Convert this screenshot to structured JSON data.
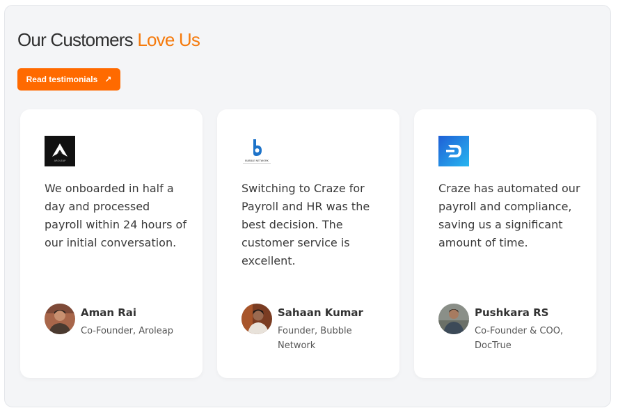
{
  "section": {
    "title_main": "Our Customers",
    "title_accent": "Love Us",
    "cta_label": "Read testimonials",
    "cta_icon": "arrow-up-right-icon",
    "accent_color": "#ff6a00"
  },
  "cards": [
    {
      "logo_icon": "aroleap-logo",
      "logo_text": "AROLEAP",
      "quote": "We onboarded in half a day and processed payroll within 24 hours of our initial conversation.",
      "name": "Aman Rai",
      "role": "Co-Founder, Aroleap"
    },
    {
      "logo_icon": "bubble-network-logo",
      "logo_text": "BUBBLE NETWORK",
      "quote": "Switching to Craze for Payroll and HR was the best decision. The customer service is excellent.",
      "name": "Sahaan Kumar",
      "role": "Founder, Bubble Network"
    },
    {
      "logo_icon": "doctrue-logo",
      "quote": "Craze has automated our payroll and compliance, saving us a significant amount of time.",
      "name": "Pushkara RS",
      "role": "Co-Founder & COO, DocTrue"
    }
  ]
}
